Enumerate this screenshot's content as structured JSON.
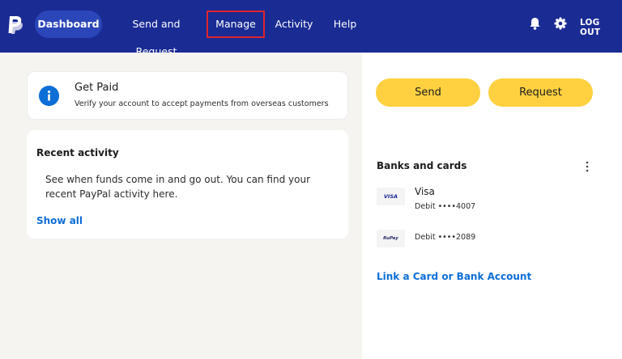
{
  "nav": {
    "dashboard": "Dashboard",
    "send_request": "Send and Request",
    "manage": "Manage",
    "activity": "Activity",
    "help": "Help",
    "logout": "LOG OUT"
  },
  "get_paid": {
    "title": "Get Paid",
    "subtitle": "Verify your account to accept payments from overseas customers"
  },
  "recent_activity": {
    "title": "Recent activity",
    "body": "See when funds come in and go out. You can find your recent PayPal activity here.",
    "show_all": "Show all"
  },
  "actions": {
    "send": "Send",
    "request": "Request"
  },
  "banks": {
    "title": "Banks and cards",
    "cards": [
      {
        "logo": "VISA",
        "name": "Visa",
        "number": "Debit ••••4007"
      },
      {
        "logo": "RuPay",
        "name": "",
        "number": "Debit ••••2089"
      }
    ],
    "link": "Link a Card or Bank Account"
  },
  "colors": {
    "header": "#1a2b94",
    "active_pill": "#2b46b8",
    "accent": "#0d6ed6",
    "button": "#ffd140",
    "highlight_border": "#e0242c"
  },
  "icons": [
    "paypal-logo-icon",
    "bell-icon",
    "gear-icon",
    "info-icon",
    "kebab-icon"
  ]
}
